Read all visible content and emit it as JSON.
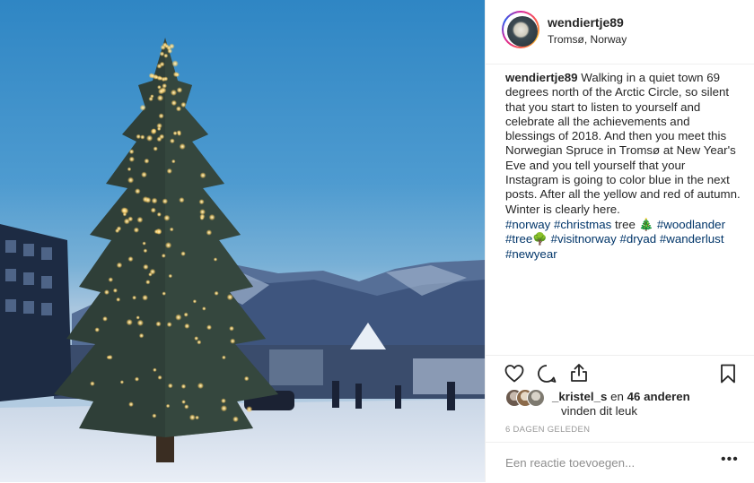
{
  "post": {
    "username": "wendiertje89",
    "location": "Tromsø, Norway",
    "caption": {
      "username": "wendiertje89",
      "text": "Walking in a quiet town 69 degrees north of the Arctic Circle, so silent that you start to listen to yourself and celebrate all the achievements and blessings of 2018. And then you meet this Norwegian Spruce in Tromsø at New Year's Eve and you tell yourself that your Instagram is going to color blue in the next posts. After all the yellow and red of autumn. Winter is clearly here.",
      "tags_line1": [
        "#norway",
        "#christmas"
      ],
      "plain_word": "tree",
      "emoji1": "🎄",
      "tags_line1b": [
        "#woodlander"
      ],
      "tags_line2": [
        "#tree"
      ],
      "emoji2": "🌳",
      "tags_line2b": [
        "#visitnorway",
        "#dryad",
        "#wanderlust"
      ],
      "tags_line3": [
        "#newyear"
      ]
    },
    "likes": {
      "first_liker": "_kristel_s",
      "connector": "en",
      "others": "46 anderen",
      "suffix": "vinden dit leuk"
    },
    "time_ago": "6 DAGEN GELEDEN",
    "comment_placeholder": "Een reactie toevoegen...",
    "more_label": "•••"
  },
  "icons": {
    "like": "heart-icon",
    "comment": "comment-bubble-icon",
    "share": "share-icon",
    "save": "bookmark-icon",
    "more": "more-options-icon"
  },
  "colors": {
    "hashtag": "#003569",
    "text": "#262626",
    "muted": "#999999",
    "divider": "#efefef",
    "sky": "#4e9bd0"
  }
}
